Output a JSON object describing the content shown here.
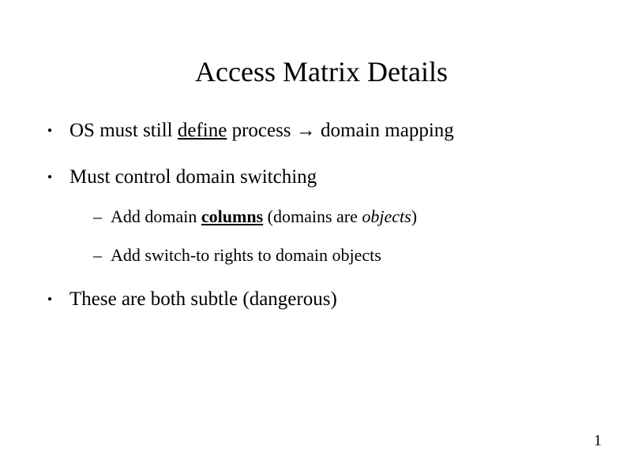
{
  "title": "Access Matrix Details",
  "bullets": {
    "b1_a": "OS must still ",
    "b1_b": "define",
    "b1_c": " process ",
    "b1_arrow": "→",
    "b1_d": " domain mapping",
    "b2": "Must control domain switching",
    "b2_1_a": "Add domain ",
    "b2_1_b": "columns",
    "b2_1_c": " (domains are ",
    "b2_1_d": "objects",
    "b2_1_e": ")",
    "b2_2": "Add switch-to rights to domain objects",
    "b3": "These are both subtle (dangerous)"
  },
  "page_number": "1"
}
